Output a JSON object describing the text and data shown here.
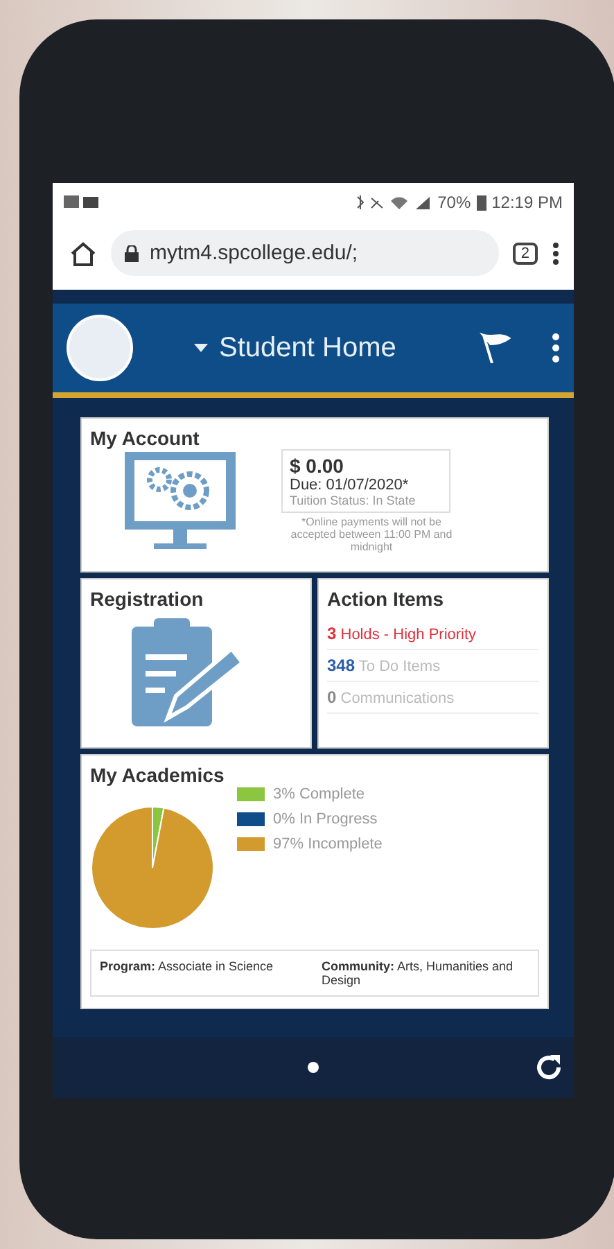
{
  "status_bar": {
    "battery": "70%",
    "time": "12:19 PM"
  },
  "browser": {
    "url": "mytm4.spcollege.edu/;",
    "tab_count": "2"
  },
  "app_header": {
    "title": "Student Home"
  },
  "my_account": {
    "title": "My Account",
    "amount": "$ 0.00",
    "due": "Due: 01/07/2020*",
    "tuition_status": "Tuition Status: In State",
    "note": "*Online payments will not be accepted between 11:00 PM and midnight"
  },
  "registration": {
    "title": "Registration"
  },
  "action_items": {
    "title": "Action Items",
    "items": [
      {
        "count": "3",
        "label": "Holds - High Priority",
        "color": "#e0303c"
      },
      {
        "count": "348",
        "label": "To Do Items",
        "color": "#2a5ea8"
      },
      {
        "count": "0",
        "label": "Communications",
        "color": "#8a8a8a"
      }
    ]
  },
  "my_academics": {
    "title": "My Academics",
    "legend": [
      {
        "label": "3% Complete",
        "color": "#8cc540"
      },
      {
        "label": "0% In Progress",
        "color": "#0f4c8a"
      },
      {
        "label": "97% Incomplete",
        "color": "#d39b2e"
      }
    ],
    "chart_data": {
      "type": "pie",
      "values": [
        3,
        0,
        97
      ]
    },
    "details": [
      "**Program:** Associate in Science",
      "**Community:** Arts, Humanities and Design"
    ]
  }
}
